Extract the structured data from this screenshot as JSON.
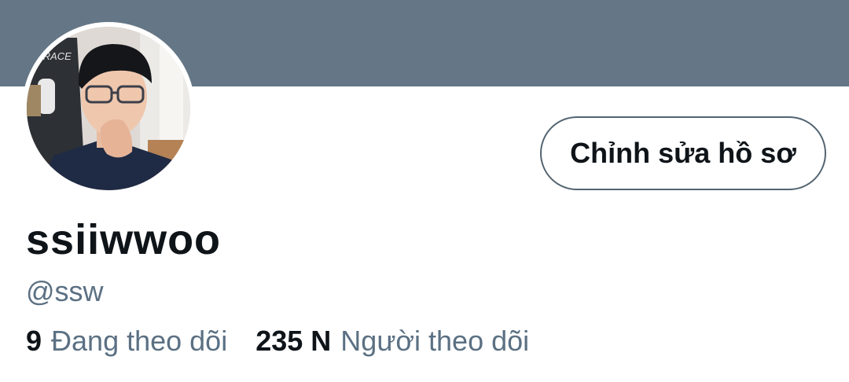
{
  "profile": {
    "display_name": "ssiiwwoo",
    "handle": "@ssw",
    "edit_button_label": "Chỉnh sửa hồ sơ",
    "avatar_overlay_text": "XRACE",
    "following_count": "9",
    "following_label": "Đang theo dõi",
    "followers_count": "235 N",
    "followers_label": "Người theo dõi"
  },
  "colors": {
    "banner": "#657786",
    "secondary_text": "#5b7083",
    "primary_text": "#0f1419",
    "button_border": "#536471"
  }
}
